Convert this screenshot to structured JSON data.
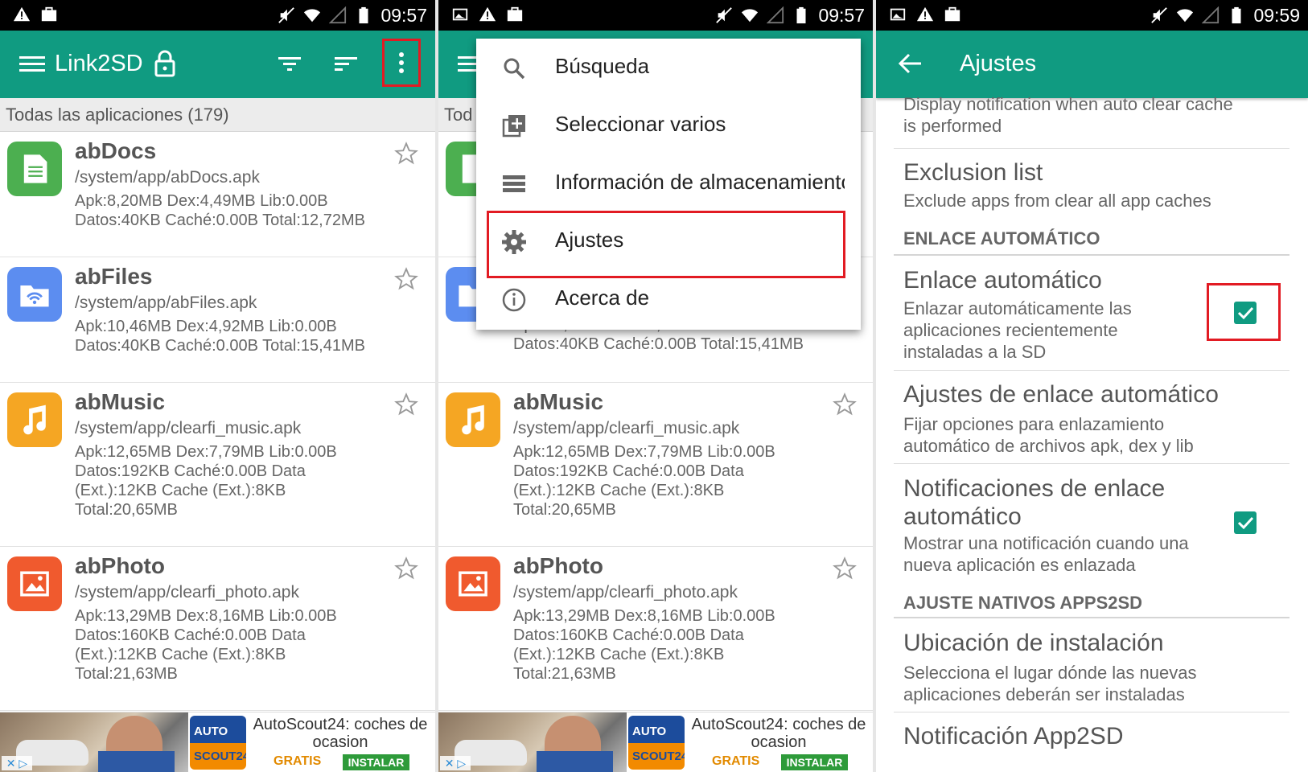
{
  "colors": {
    "accent": "#109b81",
    "highlight": "#e21b23"
  },
  "status": {
    "time1": "09:57",
    "time2": "09:57",
    "time3": "09:59"
  },
  "panel1": {
    "title": "Link2SD",
    "subheader": "Todas las aplicaciones (179)",
    "apps": [
      {
        "name": "abDocs",
        "path": "/system/app/abDocs.apk",
        "info": "Apk:8,20MB  Dex:4,49MB  Lib:0.00B\nDatos:40KB  Caché:0.00B  Total:12,72MB",
        "icon": "docs-icon"
      },
      {
        "name": "abFiles",
        "path": "/system/app/abFiles.apk",
        "info": "Apk:10,46MB  Dex:4,92MB  Lib:0.00B\nDatos:40KB  Caché:0.00B  Total:15,41MB",
        "icon": "files-icon"
      },
      {
        "name": "abMusic",
        "path": "/system/app/clearfi_music.apk",
        "info": "Apk:12,65MB  Dex:7,79MB  Lib:0.00B\nDatos:192KB  Caché:0.00B  Data\n(Ext.):12KB  Cache (Ext.):8KB\nTotal:20,65MB",
        "icon": "music-icon"
      },
      {
        "name": "abPhoto",
        "path": "/system/app/clearfi_photo.apk",
        "info": "Apk:13,29MB  Dex:8,16MB  Lib:0.00B\nDatos:160KB  Caché:0.00B  Data\n(Ext.):12KB  Cache (Ext.):8KB\nTotal:21,63MB",
        "icon": "photo-icon"
      }
    ]
  },
  "panel2": {
    "subheader": "Tod",
    "row2_info_partial": "Apk:10,46MB  Dex:4,92MB  Lib:0.00B",
    "row2_info_visible": "Datos:40KB  Caché:0.00B  Total:15,41MB",
    "menu": [
      {
        "label": "Búsqueda",
        "icon": "search-icon"
      },
      {
        "label": "Seleccionar varios",
        "icon": "add-box-icon"
      },
      {
        "label": "Información de almacenamiento",
        "icon": "storage-icon"
      },
      {
        "label": "Ajustes",
        "icon": "gear-icon"
      },
      {
        "label": "Acerca de",
        "icon": "info-icon"
      }
    ]
  },
  "ad": {
    "title": "AutoScout24: coches de ocasion",
    "free": "GRATIS",
    "install": "INSTALAR",
    "logo_top": "AUTO",
    "logo_bottom": "SCOUT24",
    "close": "✕ ▷"
  },
  "panel3": {
    "title": "Ajustes",
    "top_summary": "Display notification when auto clear cache is performed",
    "exclusion_title": "Exclusion list",
    "exclusion_summary": "Exclude apps from clear all app caches",
    "cat1": "ENLACE AUTOMÁTICO",
    "auto_link_title": "Enlace automático",
    "auto_link_summary": "Enlazar automáticamente las aplicaciones recientemente instaladas a la SD",
    "auto_link_checked": true,
    "auto_link_settings_title": "Ajustes de enlace automático",
    "auto_link_settings_summary": "Fijar opciones para enlazamiento automático de archivos apk, dex y lib",
    "notif_title": "Notificaciones de enlace automático",
    "notif_summary": "Mostrar una notificación cuando una nueva aplicación es enlazada",
    "notif_checked": true,
    "cat2": "AJUSTE NATIVOS APPS2SD",
    "location_title": "Ubicación de instalación",
    "location_summary": "Selecciona el lugar dónde las nuevas aplicaciones deberán ser instaladas",
    "app2sd_title": "Notificación App2SD"
  }
}
